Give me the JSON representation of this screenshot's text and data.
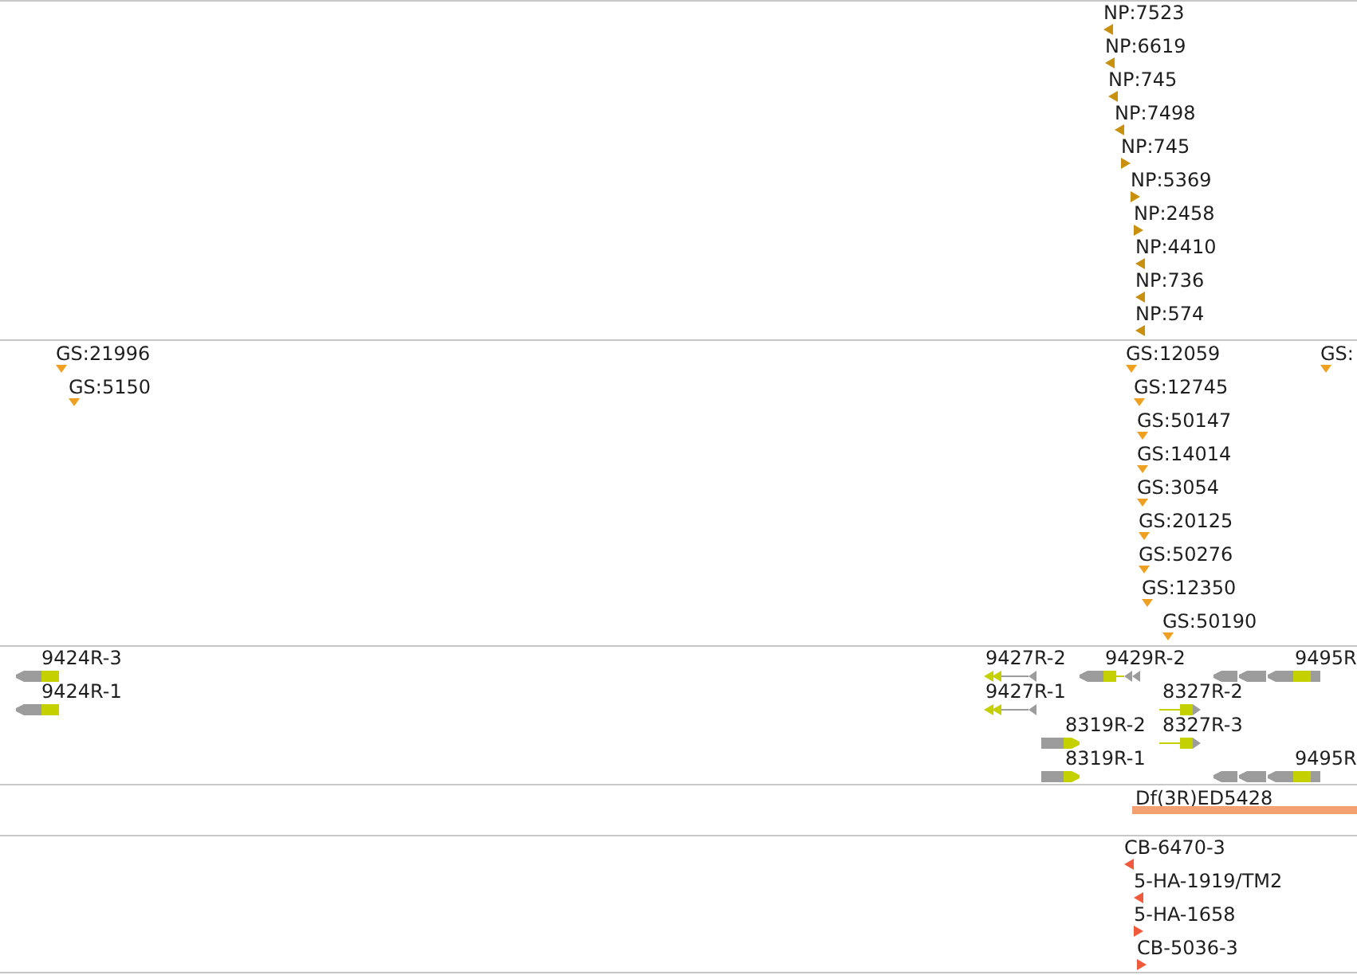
{
  "tracks": [
    {
      "kind": "markers",
      "color": "#c8900c",
      "features": [
        {
          "label": "NP:7523",
          "kind": "reverse"
        },
        {
          "label": "NP:6619",
          "kind": "reverse"
        },
        {
          "label": "NP:745",
          "kind": "reverse"
        },
        {
          "label": "NP:7498",
          "kind": "reverse"
        },
        {
          "label": "NP:745",
          "kind": "forward"
        },
        {
          "label": "NP:5369",
          "kind": "forward"
        },
        {
          "label": "NP:2458",
          "kind": "forward"
        },
        {
          "label": "NP:4410",
          "kind": "reverse"
        },
        {
          "label": "NP:736",
          "kind": "reverse"
        },
        {
          "label": "NP:574",
          "kind": "reverse"
        }
      ]
    },
    {
      "kind": "markers",
      "color": "#f0a020",
      "features": [
        {
          "label": "GS:21996",
          "kind": "point"
        },
        {
          "label": "GS:12059",
          "kind": "point"
        },
        {
          "label": "GS:",
          "kind": "point"
        },
        {
          "label": "GS:5150",
          "kind": "point"
        },
        {
          "label": "GS:12745",
          "kind": "point"
        },
        {
          "label": "GS:50147",
          "kind": "point"
        },
        {
          "label": "GS:14014",
          "kind": "point"
        },
        {
          "label": "GS:3054",
          "kind": "point"
        },
        {
          "label": "GS:20125",
          "kind": "point"
        },
        {
          "label": "GS:50276",
          "kind": "point"
        },
        {
          "label": "GS:12350",
          "kind": "point"
        },
        {
          "label": "GS:50190",
          "kind": "point"
        }
      ]
    },
    {
      "kind": "genes",
      "features": [
        {
          "label": "9424R-3",
          "kind": "reverse"
        },
        {
          "label": "9427R-2",
          "kind": "reverse"
        },
        {
          "label": "9429R-2",
          "kind": "reverse"
        },
        {
          "label": "9495R",
          "kind": "reverse"
        },
        {
          "label": "9424R-1",
          "kind": "reverse"
        },
        {
          "label": "9427R-1",
          "kind": "reverse"
        },
        {
          "label": "8327R-2",
          "kind": "forward"
        },
        {
          "label": "8319R-2",
          "kind": "forward"
        },
        {
          "label": "8327R-3",
          "kind": "forward"
        },
        {
          "label": "8319R-1",
          "kind": "forward"
        },
        {
          "label": "9495R",
          "kind": "reverse"
        }
      ]
    },
    {
      "kind": "bar",
      "color": "#f4a070",
      "features": [
        {
          "label": "Df(3R)ED5428"
        }
      ]
    },
    {
      "kind": "markers",
      "color": "#f05a3c",
      "features": [
        {
          "label": "CB-6470-3",
          "kind": "reverse"
        },
        {
          "label": "5-HA-1919/TM2",
          "kind": "reverse"
        },
        {
          "label": "5-HA-1658",
          "kind": "forward"
        },
        {
          "label": "CB-5036-3",
          "kind": "forward"
        }
      ]
    }
  ]
}
